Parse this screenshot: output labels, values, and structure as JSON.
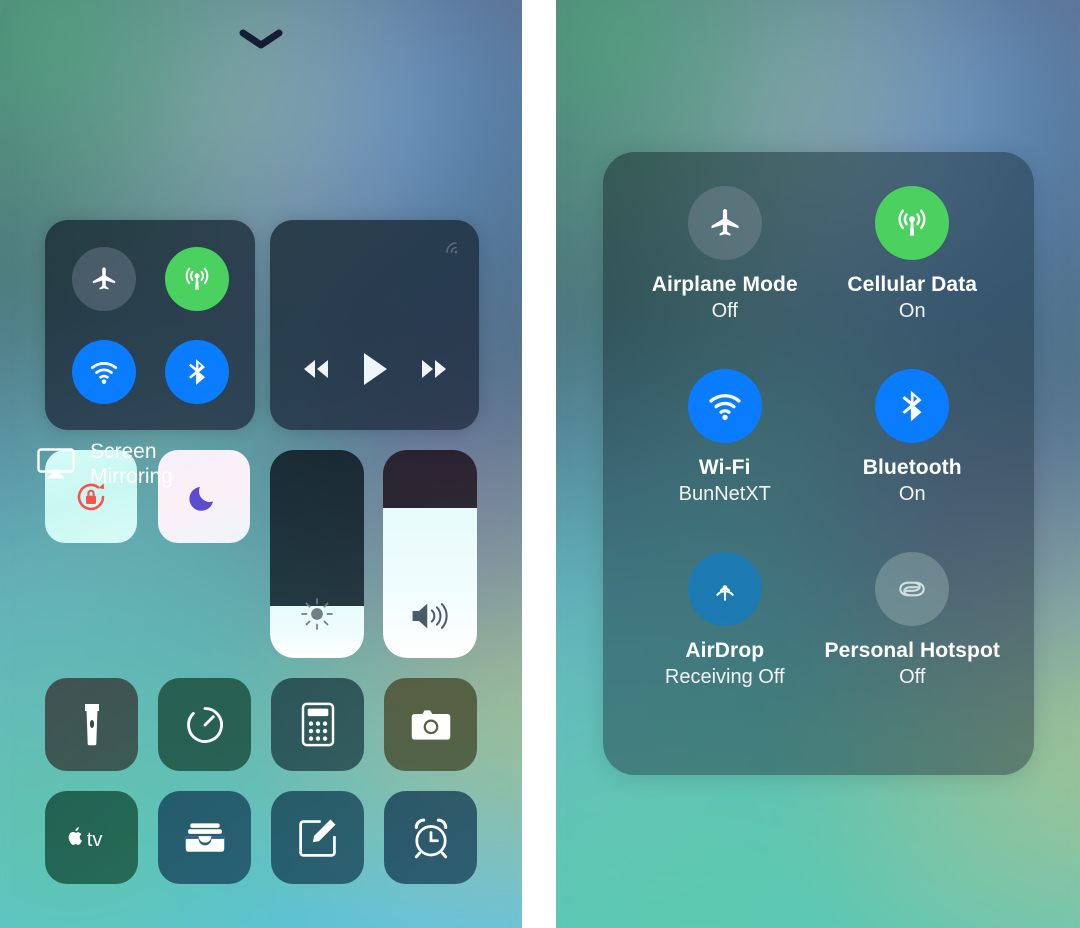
{
  "screen": {
    "title": "iOS Control Center",
    "panels": [
      "collapsed-control-center",
      "expanded-connectivity-module"
    ]
  },
  "left_panel": {
    "handle_icon": "chevron-down-icon",
    "connectivity": {
      "toggles": [
        {
          "name": "airplane-mode",
          "icon": "airplane-icon",
          "state": "off",
          "color": "#78889899"
        },
        {
          "name": "cellular-data",
          "icon": "cellular-antenna-icon",
          "state": "on",
          "color": "#4AD15F"
        },
        {
          "name": "wifi",
          "icon": "wifi-icon",
          "state": "on",
          "color": "#0A7CFF"
        },
        {
          "name": "bluetooth",
          "icon": "bluetooth-icon",
          "state": "on",
          "color": "#0A7CFF"
        }
      ]
    },
    "media": {
      "airplay_icon": "airplay-audio-icon",
      "controls": [
        {
          "name": "rewind",
          "icon": "rewind-icon"
        },
        {
          "name": "play",
          "icon": "play-icon"
        },
        {
          "name": "fast-forward",
          "icon": "fast-forward-icon"
        }
      ]
    },
    "rotation_lock": {
      "icon": "rotation-lock-icon",
      "state": "on",
      "color": "#F4534E"
    },
    "do_not_disturb": {
      "icon": "moon-icon",
      "state": "on",
      "color": "#5B4BD0"
    },
    "screen_mirroring": {
      "icon": "airplay-screen-icon",
      "label_line1": "Screen",
      "label_line2": "Mirroring"
    },
    "sliders": [
      {
        "name": "brightness",
        "icon": "brightness-sun-icon",
        "value": 25
      },
      {
        "name": "volume",
        "icon": "speaker-waves-icon",
        "value": 72
      }
    ],
    "shortcuts": [
      {
        "name": "flashlight",
        "icon": "flashlight-icon"
      },
      {
        "name": "timer",
        "icon": "timer-icon"
      },
      {
        "name": "calculator",
        "icon": "calculator-icon"
      },
      {
        "name": "camera",
        "icon": "camera-icon"
      },
      {
        "name": "apple-tv-remote",
        "icon": "apple-tv-icon"
      },
      {
        "name": "wallet",
        "icon": "wallet-icon"
      },
      {
        "name": "notes",
        "icon": "notes-pencil-icon"
      },
      {
        "name": "alarm",
        "icon": "alarm-clock-icon"
      }
    ]
  },
  "right_panel": {
    "items": [
      {
        "name": "airplane-mode",
        "icon": "airplane-icon",
        "title": "Airplane Mode",
        "status": "Off",
        "state": "off"
      },
      {
        "name": "cellular-data",
        "icon": "cellular-antenna-icon",
        "title": "Cellular Data",
        "status": "On",
        "state": "on"
      },
      {
        "name": "wifi",
        "icon": "wifi-icon",
        "title": "Wi-Fi",
        "status": "BunNetXT",
        "state": "on"
      },
      {
        "name": "bluetooth",
        "icon": "bluetooth-icon",
        "title": "Bluetooth",
        "status": "On",
        "state": "on"
      },
      {
        "name": "airdrop",
        "icon": "airdrop-icon",
        "title": "AirDrop",
        "status": "Receiving Off",
        "state": "partial"
      },
      {
        "name": "personal-hotspot",
        "icon": "hotspot-link-icon",
        "title": "Personal Hotspot",
        "status": "Off",
        "state": "off"
      }
    ]
  },
  "colors": {
    "green_on": "#4AD15F",
    "blue_on": "#0A7CFF",
    "red_lock": "#F4534E",
    "purple_moon": "#5B4BD0",
    "off_gray": "rgba(130,145,158,.40)",
    "airdrop_blue": "rgba(24,122,186,.88)"
  }
}
